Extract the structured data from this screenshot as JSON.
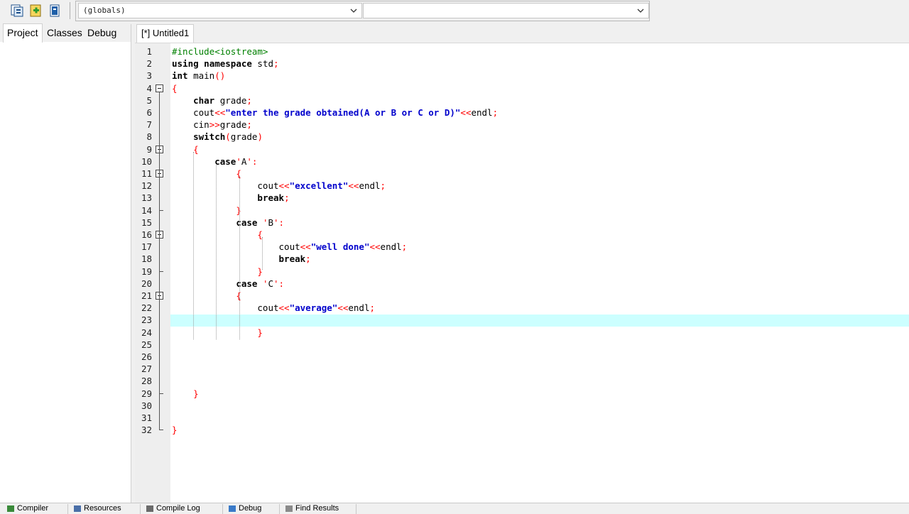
{
  "toolbar": {
    "buttons": [
      {
        "icon": "project-options-icon",
        "color": "#1e6fb8"
      },
      {
        "icon": "add-to-project-icon",
        "color": "#2e9b2e"
      },
      {
        "icon": "remove-from-project-icon",
        "color": "#1e5fa8"
      }
    ],
    "scope_combo_value": "(globals)",
    "member_combo_value": ""
  },
  "left_panel": {
    "tabs": [
      "Project",
      "Classes",
      "Debug"
    ],
    "active_tab": "Project"
  },
  "editor": {
    "tab_label": "[*] Untitled1",
    "current_line": 23,
    "highlight_color": "#ccffff",
    "line_numbers": [
      "1",
      "2",
      "3",
      "4",
      "5",
      "6",
      "7",
      "8",
      "9",
      "10",
      "11",
      "12",
      "13",
      "14",
      "15",
      "16",
      "17",
      "18",
      "19",
      "20",
      "21",
      "22",
      "23",
      "24",
      "25",
      "26",
      "27",
      "28",
      "29",
      "30",
      "31",
      "32"
    ],
    "fold_markers": {
      "open": [
        4,
        9,
        11,
        16,
        21
      ],
      "close": [
        14,
        19,
        29,
        32
      ]
    },
    "lines": [
      "#include<iostream>",
      "using namespace std;",
      "int main()",
      "{",
      "    char grade;",
      "    cout<<\"enter the grade obtained(A or B or C or D)\"<<endl;",
      "    cin>>grade;",
      "    switch(grade)",
      "    {",
      "        case'A':",
      "            {",
      "                cout<<\"excellent\"<<endl;",
      "                break;",
      "            }",
      "            case 'B':",
      "                {",
      "                    cout<<\"well done\"<<endl;",
      "                    break;",
      "                }",
      "            case 'C':",
      "            {",
      "                cout<<\"average\"<<endl;",
      "",
      "                }",
      "",
      "",
      "",
      "",
      "    }",
      "",
      "",
      "}"
    ]
  },
  "bottom_tabs": [
    {
      "label": "Compiler",
      "icon": "compiler-icon"
    },
    {
      "label": "Resources",
      "icon": "resources-icon"
    },
    {
      "label": "Compile Log",
      "icon": "compile-log-icon"
    },
    {
      "label": "Debug",
      "icon": "debug-icon"
    },
    {
      "label": "Find Results",
      "icon": "find-results-icon"
    }
  ]
}
